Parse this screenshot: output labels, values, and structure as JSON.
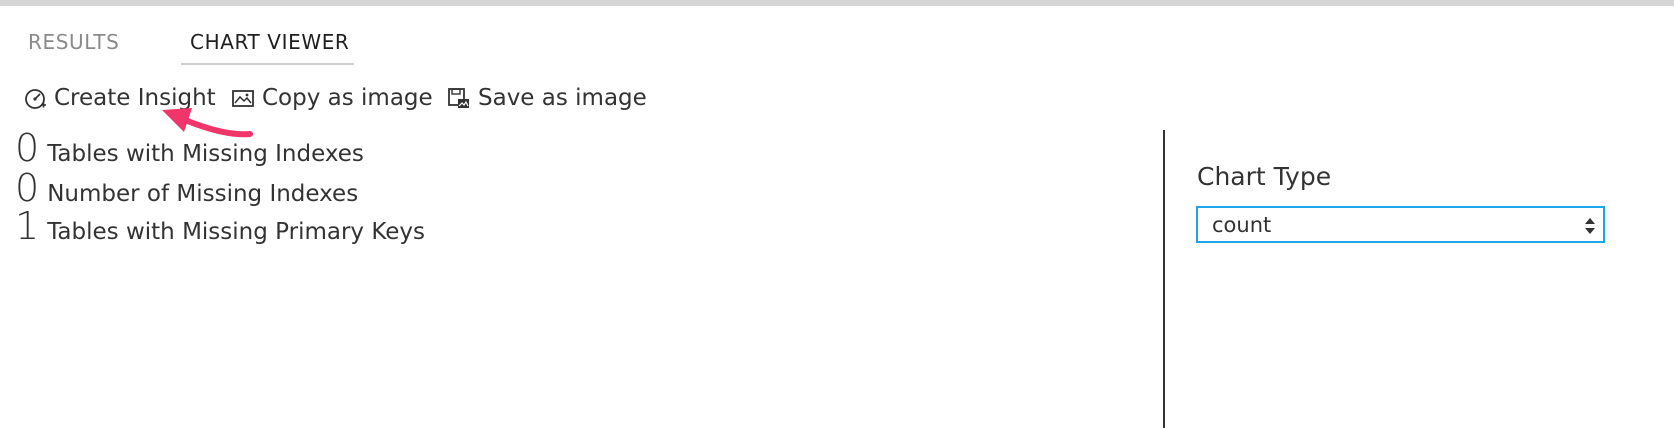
{
  "tabs": [
    {
      "label": "RESULTS",
      "active": false
    },
    {
      "label": "CHART VIEWER",
      "active": true
    }
  ],
  "toolbar": {
    "create_insight": {
      "label": "Create Insight",
      "icon": "dashboard-gauge-icon"
    },
    "copy_image": {
      "label": "Copy as image",
      "icon": "image-icon"
    },
    "save_image": {
      "label": "Save as image",
      "icon": "save-image-icon"
    }
  },
  "counts": [
    {
      "value": "0",
      "label": "Tables with Missing Indexes"
    },
    {
      "value": "0",
      "label": "Number of Missing Indexes"
    },
    {
      "value": "1",
      "label": "Tables with Missing Primary Keys"
    }
  ],
  "chart_settings": {
    "chart_type_label": "Chart Type",
    "chart_type_value": "count"
  },
  "colors": {
    "accent_border": "#1fa6e8",
    "annotation_arrow": "#f0356b"
  }
}
